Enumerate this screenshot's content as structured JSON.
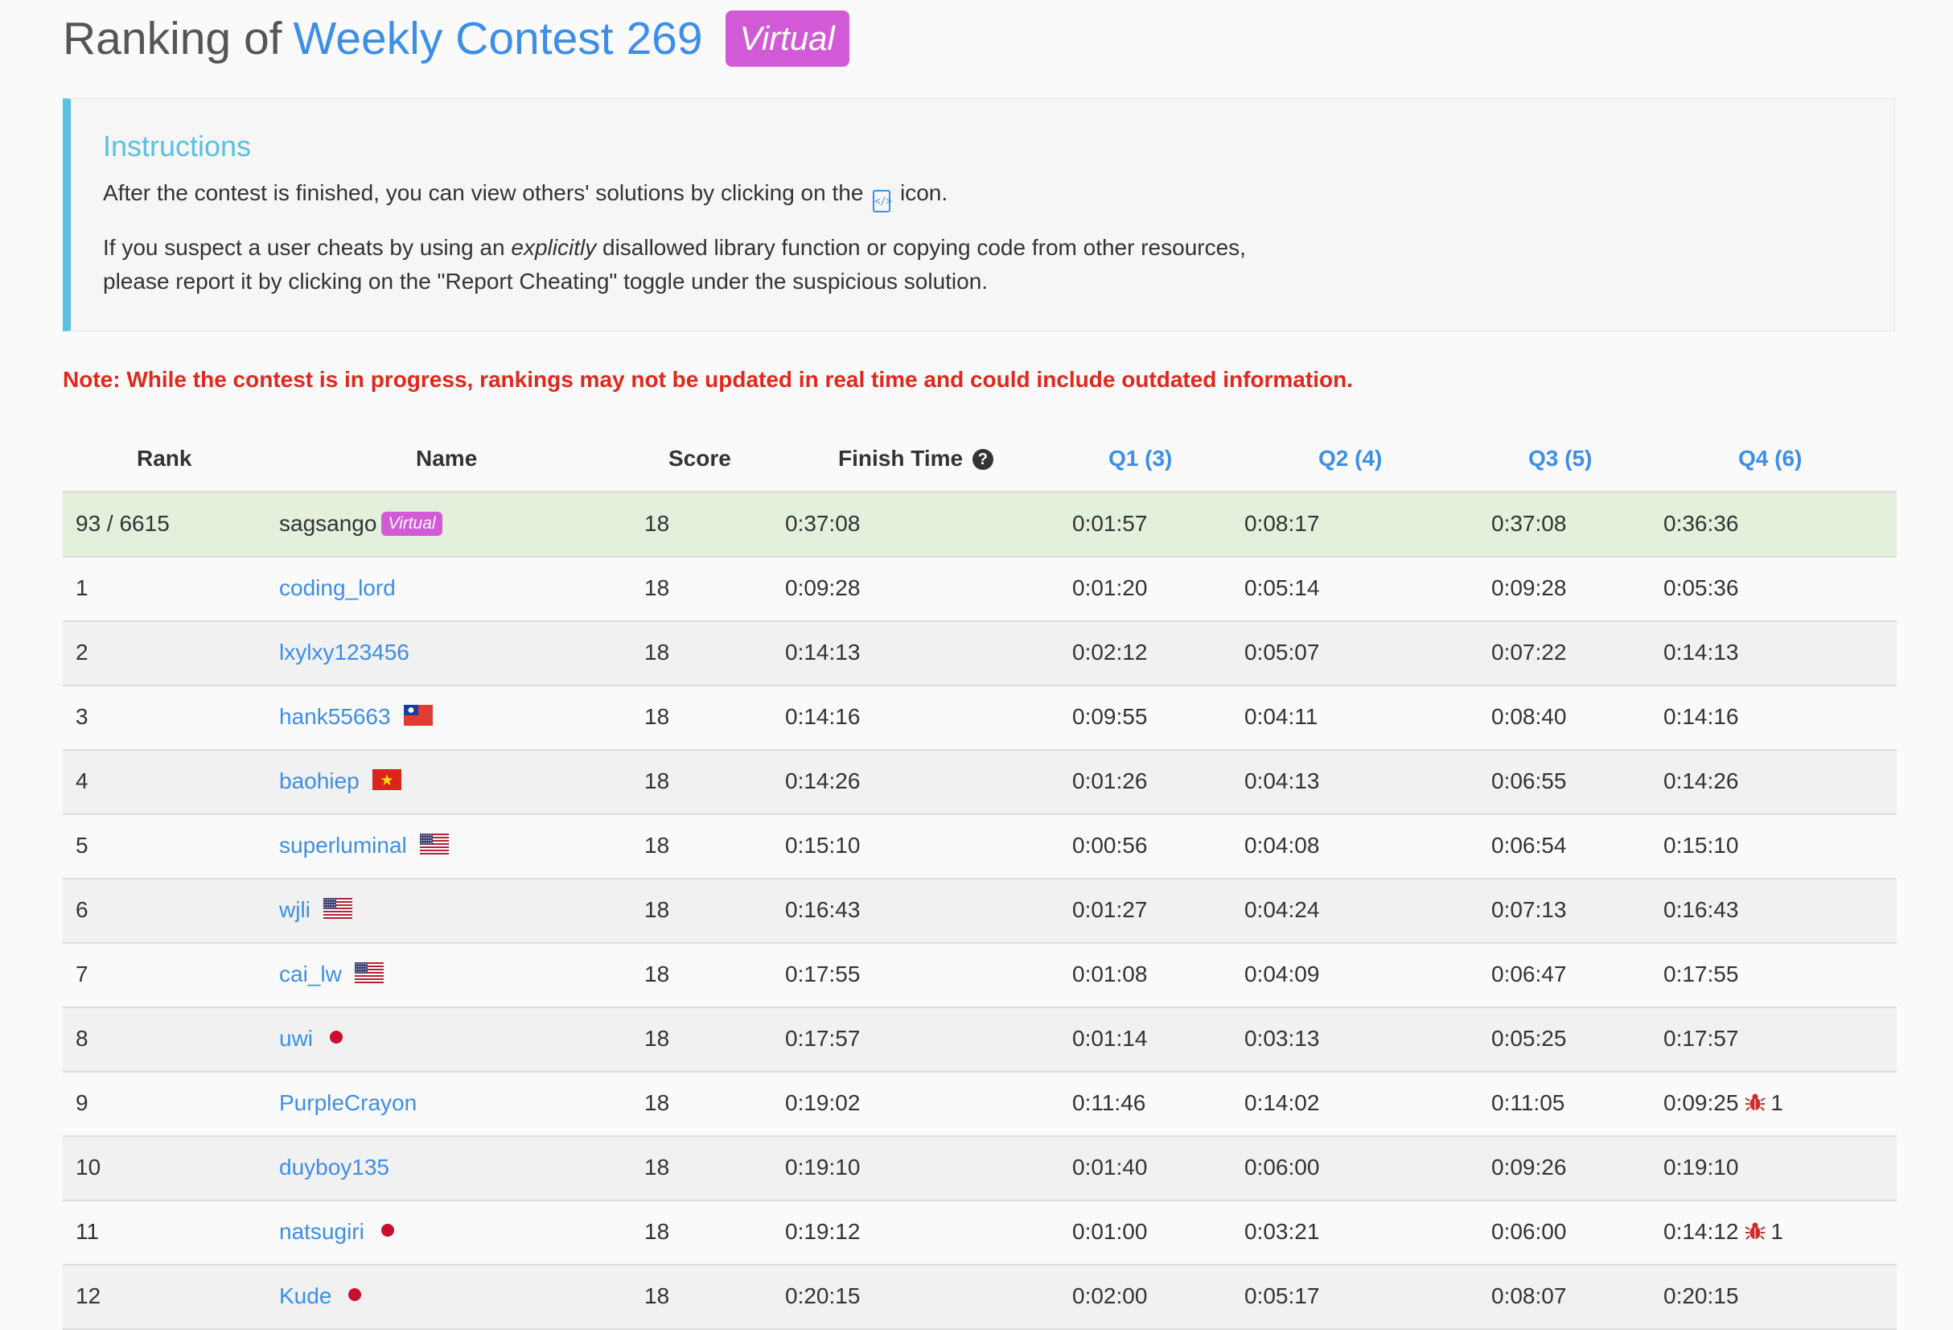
{
  "header": {
    "prefix": "Ranking of",
    "contest": "Weekly Contest 269",
    "badge": "Virtual"
  },
  "instructions": {
    "title": "Instructions",
    "line1_before": "After the contest is finished, you can view others' solutions by clicking on the",
    "line1_after": "icon.",
    "line2_before": "If you suspect a user cheats by using an",
    "line2_em": "explicitly",
    "line2_after": "disallowed library function or copying code from other resources,",
    "line3": "please report it by clicking on the \"Report Cheating\" toggle under the suspicious solution."
  },
  "note": "Note: While the contest is in progress, rankings may not be updated in real time and could include outdated information.",
  "table": {
    "headers": {
      "rank": "Rank",
      "name": "Name",
      "score": "Score",
      "finish": "Finish Time",
      "q1": "Q1 (3)",
      "q2": "Q2 (4)",
      "q3": "Q3 (5)",
      "q4": "Q4 (6)"
    },
    "rows": [
      {
        "rank": "93 / 6615",
        "name": "sagsango",
        "virtual": "Virtual",
        "score": "18",
        "finish": "0:37:08",
        "q1": "0:01:57",
        "q2": "0:08:17",
        "q3": "0:37:08",
        "q4": "0:36:36",
        "mine": true
      },
      {
        "rank": "1",
        "name": "coding_lord",
        "score": "18",
        "finish": "0:09:28",
        "q1": "0:01:20",
        "q2": "0:05:14",
        "q3": "0:09:28",
        "q4": "0:05:36"
      },
      {
        "rank": "2",
        "name": "lxylxy123456",
        "score": "18",
        "finish": "0:14:13",
        "q1": "0:02:12",
        "q2": "0:05:07",
        "q3": "0:07:22",
        "q4": "0:14:13"
      },
      {
        "rank": "3",
        "name": "hank55663",
        "flag": "tw",
        "score": "18",
        "finish": "0:14:16",
        "q1": "0:09:55",
        "q2": "0:04:11",
        "q3": "0:08:40",
        "q4": "0:14:16"
      },
      {
        "rank": "4",
        "name": "baohiep",
        "flag": "vn",
        "score": "18",
        "finish": "0:14:26",
        "q1": "0:01:26",
        "q2": "0:04:13",
        "q3": "0:06:55",
        "q4": "0:14:26"
      },
      {
        "rank": "5",
        "name": "superluminal",
        "flag": "us",
        "score": "18",
        "finish": "0:15:10",
        "q1": "0:00:56",
        "q2": "0:04:08",
        "q3": "0:06:54",
        "q4": "0:15:10"
      },
      {
        "rank": "6",
        "name": "wjli",
        "flag": "us",
        "score": "18",
        "finish": "0:16:43",
        "q1": "0:01:27",
        "q2": "0:04:24",
        "q3": "0:07:13",
        "q4": "0:16:43"
      },
      {
        "rank": "7",
        "name": "cai_lw",
        "flag": "us",
        "score": "18",
        "finish": "0:17:55",
        "q1": "0:01:08",
        "q2": "0:04:09",
        "q3": "0:06:47",
        "q4": "0:17:55"
      },
      {
        "rank": "8",
        "name": "uwi",
        "flag": "jp",
        "score": "18",
        "finish": "0:17:57",
        "q1": "0:01:14",
        "q2": "0:03:13",
        "q3": "0:05:25",
        "q4": "0:17:57"
      },
      {
        "rank": "9",
        "name": "PurpleCrayon",
        "score": "18",
        "finish": "0:19:02",
        "q1": "0:11:46",
        "q2": "0:14:02",
        "q3": "0:11:05",
        "q4": "0:09:25",
        "q4_bugs": "1"
      },
      {
        "rank": "10",
        "name": "duyboy135",
        "score": "18",
        "finish": "0:19:10",
        "q1": "0:01:40",
        "q2": "0:06:00",
        "q3": "0:09:26",
        "q4": "0:19:10"
      },
      {
        "rank": "11",
        "name": "natsugiri",
        "flag": "jp",
        "score": "18",
        "finish": "0:19:12",
        "q1": "0:01:00",
        "q2": "0:03:21",
        "q3": "0:06:00",
        "q4": "0:14:12",
        "q4_bugs": "1"
      },
      {
        "rank": "12",
        "name": "Kude",
        "flag": "jp",
        "score": "18",
        "finish": "0:20:15",
        "q1": "0:02:00",
        "q2": "0:05:17",
        "q3": "0:08:07",
        "q4": "0:20:15"
      }
    ]
  },
  "colors": {
    "link": "#3d8ee8",
    "virtual_badge": "#d25ad6",
    "note": "#e0281e",
    "instructions_accent": "#5bc0de",
    "highlight_row": "#e3f0dc",
    "bug": "#c9302c"
  }
}
